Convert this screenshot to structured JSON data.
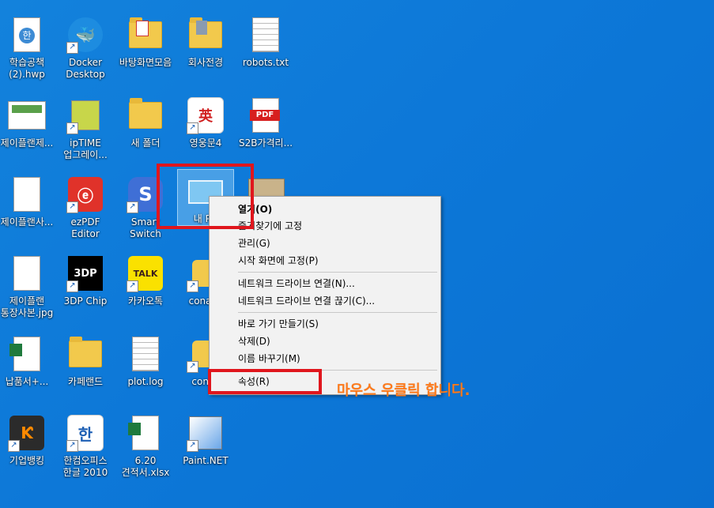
{
  "desktop_icons": [
    {
      "label": "학습공책\n(2).hwp",
      "icon": "hwp-document-icon"
    },
    {
      "label": "Docker\nDesktop",
      "icon": "docker-icon"
    },
    {
      "label": "바탕화면모음",
      "icon": "folder-icon"
    },
    {
      "label": "회사전경",
      "icon": "folder-icon"
    },
    {
      "label": "robots.txt",
      "icon": "text-file-icon"
    },
    {
      "label": "제이플랜제...",
      "icon": "image-file-icon"
    },
    {
      "label": "ipTIME\n업그레이...",
      "icon": "iptime-icon"
    },
    {
      "label": "새 폴더",
      "icon": "folder-icon"
    },
    {
      "label": "영웅문4",
      "icon": "youngwoongmoon-icon"
    },
    {
      "label": "S2B가격리...",
      "icon": "pdf-icon"
    },
    {
      "label": "제이플랜사...",
      "icon": "image-file-icon"
    },
    {
      "label": "ezPDF Editor",
      "icon": "ezpdf-icon"
    },
    {
      "label": "Smart Switch",
      "icon": "smart-switch-icon"
    },
    {
      "label": "내 PC",
      "icon": "this-pc-icon"
    },
    {
      "label": "제이플랜\n통장사본.jpg",
      "icon": "image-file-icon"
    },
    {
      "label": "3DP Chip",
      "icon": "3dp-chip-icon"
    },
    {
      "label": "카카오톡",
      "icon": "kakaotalk-icon"
    },
    {
      "label": "conas3",
      "icon": "python-file-icon"
    },
    {
      "label": "납품서+...",
      "icon": "excel-file-icon"
    },
    {
      "label": "카페랜드",
      "icon": "folder-icon"
    },
    {
      "label": "plot.log",
      "icon": "text-file-icon"
    },
    {
      "label": "conas",
      "icon": "python-file-icon"
    },
    {
      "label": "기업뱅킹",
      "icon": "banking-icon"
    },
    {
      "label": "한컴오피스\n한글 2010",
      "icon": "hancom-icon"
    },
    {
      "label": "6.20\n견적서.xlsx",
      "icon": "excel-file-icon"
    },
    {
      "label": "Paint.NET",
      "icon": "paintnet-icon"
    }
  ],
  "context_menu": {
    "items": [
      {
        "label": "열기(O)",
        "bold": true
      },
      {
        "label": "즐겨찾기에 고정"
      },
      {
        "label": "관리(G)"
      },
      {
        "label": "시작 화면에 고정(P)"
      },
      {
        "label": "네트워크 드라이브 연결(N)..."
      },
      {
        "label": "네트워크 드라이브 연결 끊기(C)..."
      },
      {
        "label": "바로 가기 만들기(S)"
      },
      {
        "label": "삭제(D)"
      },
      {
        "label": "이름 바꾸기(M)"
      },
      {
        "label": "속성(R)"
      }
    ]
  },
  "annotation": {
    "text": "마우스 우클릭 합니다."
  },
  "colors": {
    "desktop": "#0d78d8",
    "highlight": "#e0161d",
    "annotation": "#ff7a1a"
  }
}
